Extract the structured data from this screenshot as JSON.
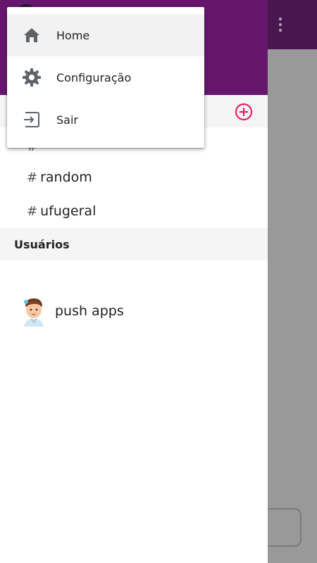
{
  "menu": {
    "items": [
      {
        "label": "Home",
        "icon": "home-icon"
      },
      {
        "label": "Configuração",
        "icon": "gear-icon"
      },
      {
        "label": "Sair",
        "icon": "logout-icon"
      }
    ]
  },
  "drawer": {
    "channels": [
      {
        "hash": "#",
        "name": ""
      },
      {
        "hash": "#",
        "name": "random"
      },
      {
        "hash": "#",
        "name": "ufugeral"
      }
    ],
    "users_header": "Usuários",
    "users": [
      {
        "name": "push apps"
      }
    ]
  },
  "colors": {
    "drawer_header": "#66176d",
    "app_bar": "#4a1650",
    "accent": "#e91e63"
  }
}
